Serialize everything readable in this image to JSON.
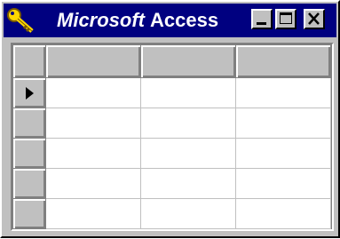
{
  "window": {
    "title_brand": "Microsoft",
    "title_app": "Access",
    "icon": "key-icon",
    "controls": {
      "minimize": "minimize-icon",
      "maximize": "maximize-icon",
      "close": "close-icon"
    }
  },
  "datasheet": {
    "columns": [
      "",
      "",
      ""
    ],
    "rows": [
      {
        "current": true,
        "cells": [
          "",
          "",
          ""
        ]
      },
      {
        "current": false,
        "cells": [
          "",
          "",
          ""
        ]
      },
      {
        "current": false,
        "cells": [
          "",
          "",
          ""
        ]
      },
      {
        "current": false,
        "cells": [
          "",
          "",
          ""
        ]
      },
      {
        "current": false,
        "cells": [
          "",
          "",
          ""
        ]
      }
    ],
    "current_record_icon": "record-pointer-icon"
  },
  "colors": {
    "title_bar": "#000080",
    "face": "#c0c0c0",
    "shadow": "#808080",
    "highlight": "#ffffff"
  }
}
